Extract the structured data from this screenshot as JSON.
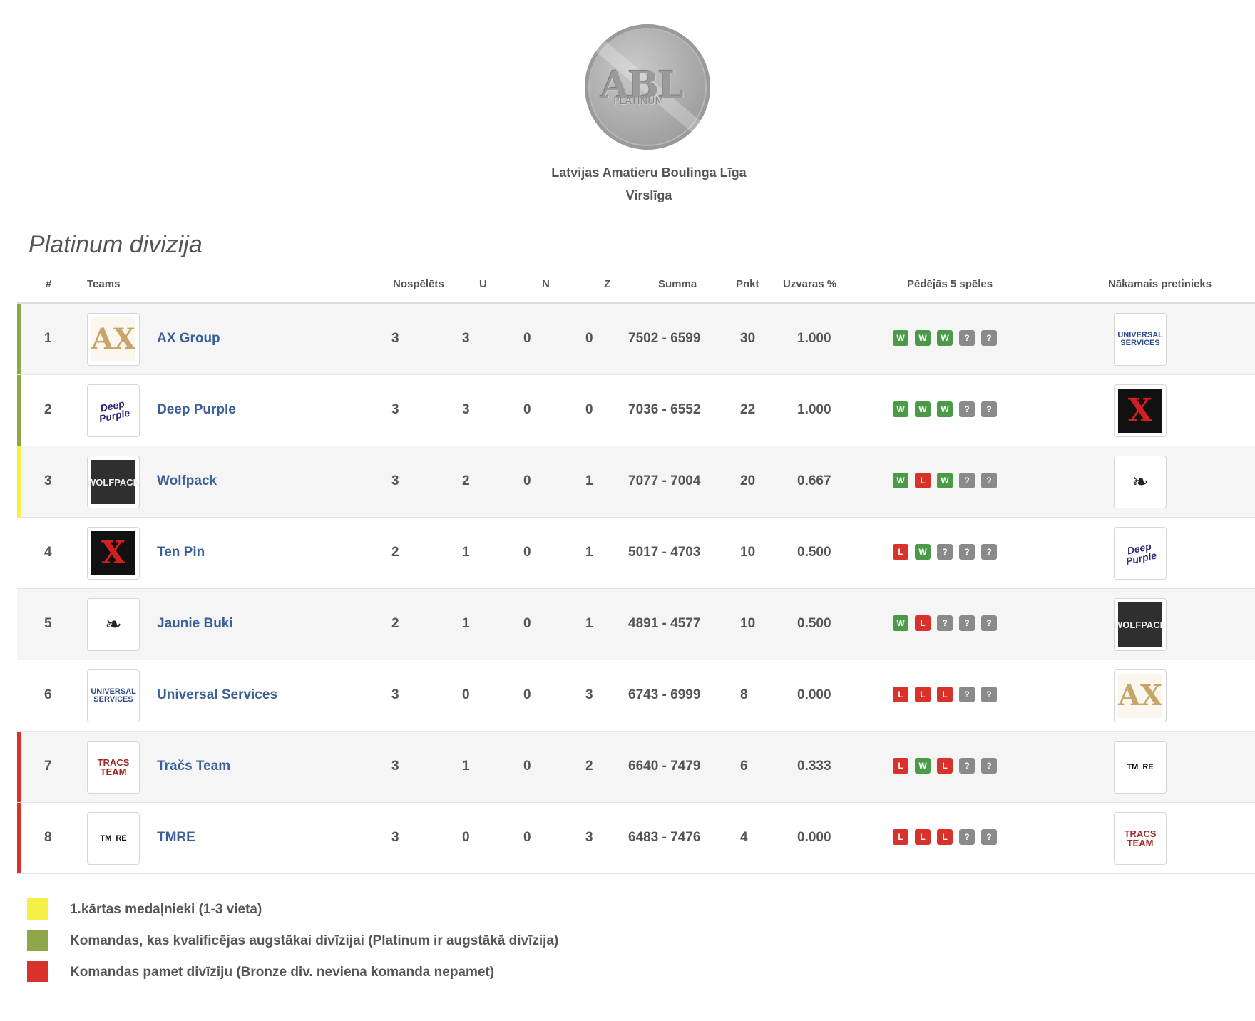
{
  "header": {
    "logo_text": "ABL",
    "logo_subtext": "PLATINUM",
    "league_name": "Latvijas Amatieru Boulinga Līga",
    "league_tier": "Virslīga"
  },
  "division_title": "Platinum divizija",
  "columns": {
    "rank": "#",
    "teams": "Teams",
    "played": "Nospēlēts",
    "wins": "U",
    "draws": "N",
    "losses": "Z",
    "sum": "Summa",
    "points": "Pnkt",
    "win_pct": "Uzvaras %",
    "last5": "Pēdējās 5 spēles",
    "next_opponent": "Nākamais pretinieks"
  },
  "colors": {
    "medal": "#f5f046",
    "qualify": "#8fa649",
    "relegate": "#d8322b",
    "win": "#4a9a48",
    "loss": "#d8322b",
    "unknown": "#8a8a8a",
    "team_link": "#3a5f99"
  },
  "rows": [
    {
      "rank": "1",
      "team": "AX Group",
      "logo": "ax-group-logo",
      "played": "3",
      "w": "3",
      "d": "0",
      "l": "0",
      "sum": "7502 - 6599",
      "pts": "30",
      "pct": "1.000",
      "status": "qualify",
      "form": [
        "W",
        "W",
        "W",
        "?",
        "?"
      ],
      "next_logo": "universal-services-logo"
    },
    {
      "rank": "2",
      "team": "Deep Purple",
      "logo": "deep-purple-logo",
      "played": "3",
      "w": "3",
      "d": "0",
      "l": "0",
      "sum": "7036 - 6552",
      "pts": "22",
      "pct": "1.000",
      "status": "qualify",
      "form": [
        "W",
        "W",
        "W",
        "?",
        "?"
      ],
      "next_logo": "ten-pin-logo"
    },
    {
      "rank": "3",
      "team": "Wolfpack",
      "logo": "wolfpack-logo",
      "played": "3",
      "w": "2",
      "d": "0",
      "l": "1",
      "sum": "7077 - 7004",
      "pts": "20",
      "pct": "0.667",
      "status": "medal",
      "form": [
        "W",
        "L",
        "W",
        "?",
        "?"
      ],
      "next_logo": "jaunie-buki-logo"
    },
    {
      "rank": "4",
      "team": "Ten Pin",
      "logo": "ten-pin-logo",
      "played": "2",
      "w": "1",
      "d": "0",
      "l": "1",
      "sum": "5017 - 4703",
      "pts": "10",
      "pct": "0.500",
      "status": "none",
      "form": [
        "L",
        "W",
        "?",
        "?",
        "?"
      ],
      "next_logo": "deep-purple-logo"
    },
    {
      "rank": "5",
      "team": "Jaunie Buki",
      "logo": "jaunie-buki-logo",
      "played": "2",
      "w": "1",
      "d": "0",
      "l": "1",
      "sum": "4891 - 4577",
      "pts": "10",
      "pct": "0.500",
      "status": "none",
      "form": [
        "W",
        "L",
        "?",
        "?",
        "?"
      ],
      "next_logo": "wolfpack-logo"
    },
    {
      "rank": "6",
      "team": "Universal Services",
      "logo": "universal-services-logo",
      "played": "3",
      "w": "0",
      "d": "0",
      "l": "3",
      "sum": "6743 - 6999",
      "pts": "8",
      "pct": "0.000",
      "status": "none",
      "form": [
        "L",
        "L",
        "L",
        "?",
        "?"
      ],
      "next_logo": "ax-group-logo"
    },
    {
      "rank": "7",
      "team": "Tračs Team",
      "logo": "tracs-team-logo",
      "played": "3",
      "w": "1",
      "d": "0",
      "l": "2",
      "sum": "6640 - 7479",
      "pts": "6",
      "pct": "0.333",
      "status": "relegate",
      "form": [
        "L",
        "W",
        "L",
        "?",
        "?"
      ],
      "next_logo": "tmre-logo"
    },
    {
      "rank": "8",
      "team": "TMRE",
      "logo": "tmre-logo",
      "played": "3",
      "w": "0",
      "d": "0",
      "l": "3",
      "sum": "6483 - 7476",
      "pts": "4",
      "pct": "0.000",
      "status": "relegate",
      "form": [
        "L",
        "L",
        "L",
        "?",
        "?"
      ],
      "next_logo": "tracs-team-logo"
    }
  ],
  "legend": [
    {
      "key": "medal",
      "label": "1.kārtas medaļnieki (1-3 vieta)"
    },
    {
      "key": "qualify",
      "label": "Komandas, kas kvalificējas augstākai divīzijai (Platinum ir augstākā divīzija)"
    },
    {
      "key": "relegate",
      "label": "Komandas pamet divīziju (Bronze div. neviena komanda nepamet)"
    }
  ]
}
